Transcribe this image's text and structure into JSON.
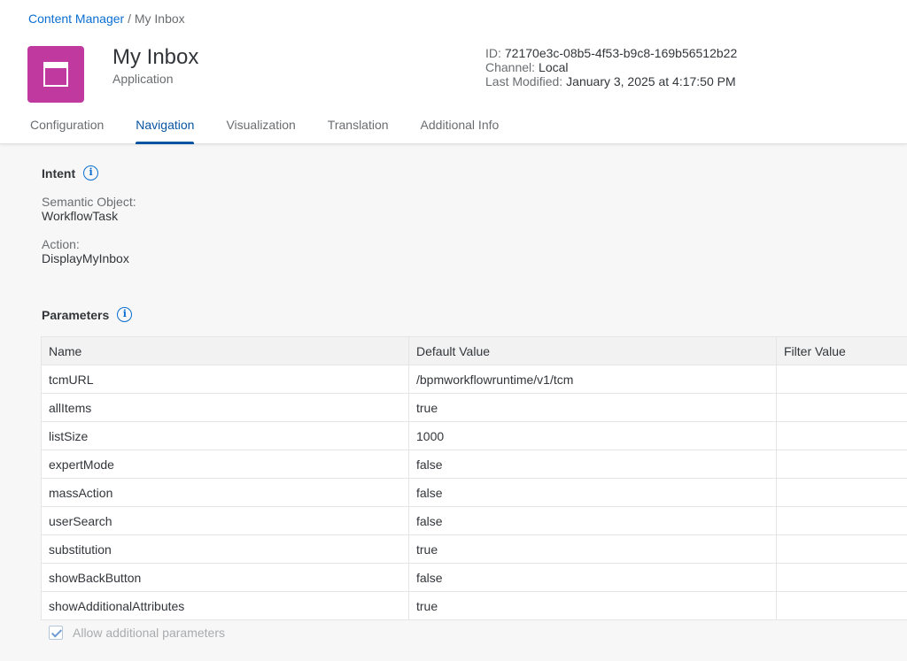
{
  "breadcrumb": {
    "parent": "Content Manager",
    "separator": " / ",
    "current": "My Inbox"
  },
  "header": {
    "title": "My Inbox",
    "subtitle": "Application",
    "icon": "application-window-icon",
    "icon_color": "#c0399f",
    "meta": {
      "id_label": "ID:",
      "id_value": "72170e3c-08b5-4f53-b9c8-169b56512b22",
      "channel_label": "Channel:",
      "channel_value": "Local",
      "modified_label": "Last Modified:",
      "modified_value": "January 3, 2025 at 4:17:50 PM"
    }
  },
  "tabs": [
    {
      "label": "Configuration",
      "active": false
    },
    {
      "label": "Navigation",
      "active": true
    },
    {
      "label": "Visualization",
      "active": false
    },
    {
      "label": "Translation",
      "active": false
    },
    {
      "label": "Additional Info",
      "active": false
    }
  ],
  "intent": {
    "title": "Intent",
    "semantic_object_label": "Semantic Object:",
    "semantic_object_value": "WorkflowTask",
    "action_label": "Action:",
    "action_value": "DisplayMyInbox"
  },
  "parameters": {
    "title": "Parameters",
    "columns": [
      "Name",
      "Default Value",
      "Filter Value"
    ],
    "rows": [
      {
        "name": "tcmURL",
        "default": "/bpmworkflowruntime/v1/tcm",
        "filter": ""
      },
      {
        "name": "allItems",
        "default": "true",
        "filter": ""
      },
      {
        "name": "listSize",
        "default": "1000",
        "filter": ""
      },
      {
        "name": "expertMode",
        "default": "false",
        "filter": ""
      },
      {
        "name": "massAction",
        "default": "false",
        "filter": ""
      },
      {
        "name": "userSearch",
        "default": "false",
        "filter": ""
      },
      {
        "name": "substitution",
        "default": "true",
        "filter": ""
      },
      {
        "name": "showBackButton",
        "default": "false",
        "filter": ""
      },
      {
        "name": "showAdditionalAttributes",
        "default": "true",
        "filter": ""
      }
    ],
    "allow_additional_label": "Allow additional parameters",
    "allow_additional_checked": true
  },
  "colors": {
    "accent": "#0854a0",
    "link": "#0a6ed1"
  }
}
